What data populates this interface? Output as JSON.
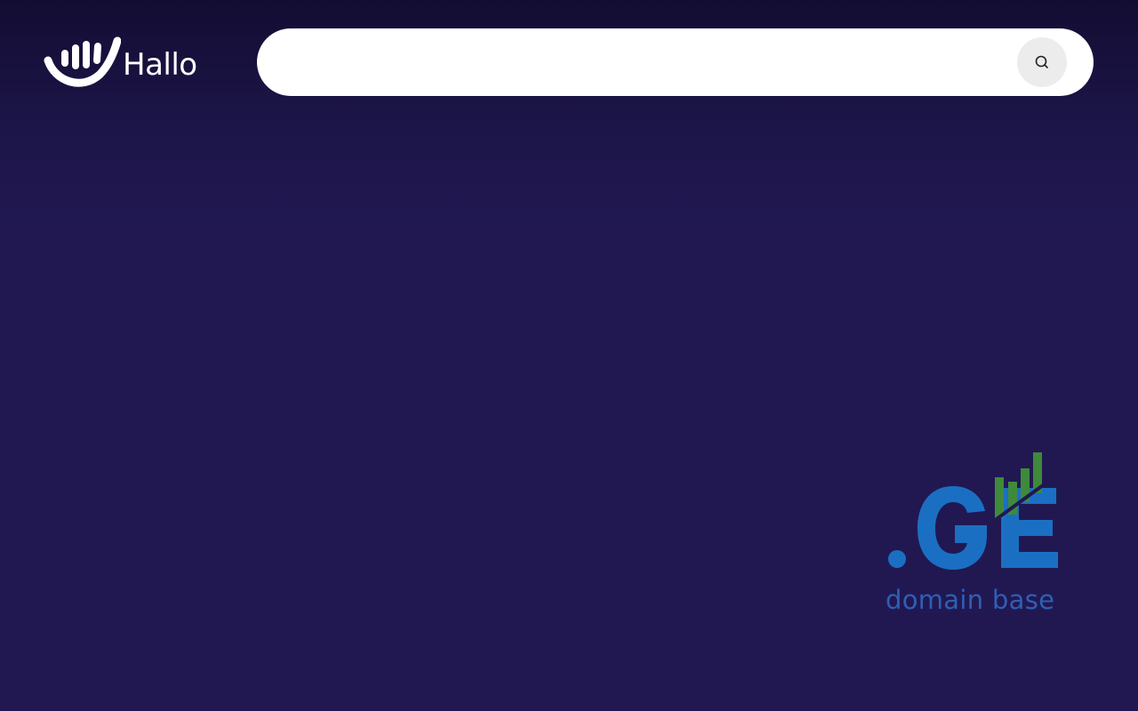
{
  "brand": {
    "name": "Hallo",
    "logo_icon": "waving-hand-icon"
  },
  "search": {
    "value": "",
    "placeholder": "",
    "button_icon": "search-icon"
  },
  "watermark": {
    "logo_text": ".GE",
    "caption": "domain base",
    "colors": {
      "primary": "#1b6fc2",
      "bars": "#3f8a3a",
      "caption": "#2f5fb3"
    }
  },
  "colors": {
    "background": "#211852",
    "search_bg": "#ffffff",
    "search_button_bg": "#ececec"
  }
}
